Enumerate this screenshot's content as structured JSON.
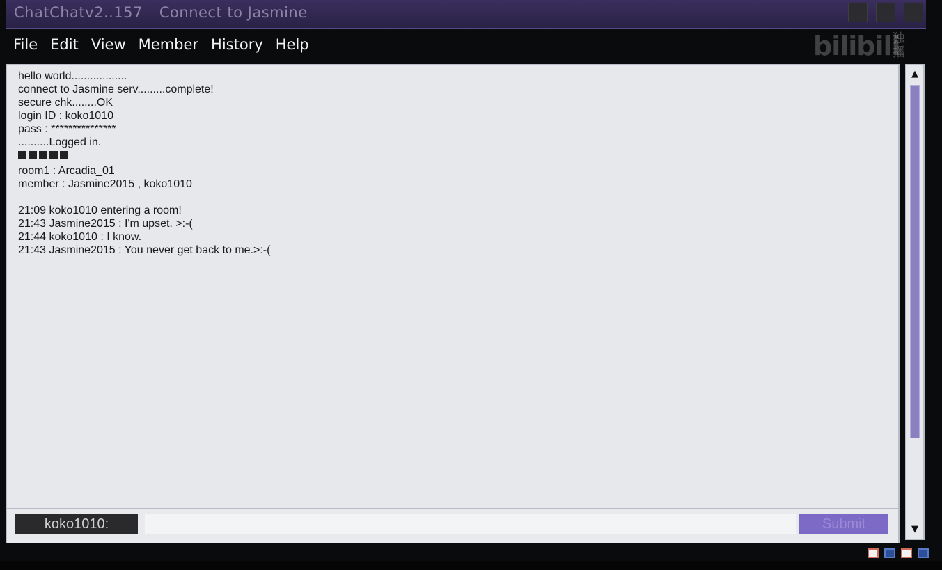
{
  "window": {
    "app_name": "ChatChatv2..157",
    "title": "Connect to Jasmine"
  },
  "menu": [
    "File",
    "Edit",
    "View",
    "Member",
    "History",
    "Help"
  ],
  "watermark": {
    "brand": "bilibili",
    "tag": "独播"
  },
  "log": [
    "hello world..................",
    "connect to Jasmine serv.........complete!",
    "secure chk........OK",
    "login ID : koko1010",
    "pass : ***************",
    "..........Logged in.",
    "",
    "room1 : Arcadia_01",
    "member : Jasmine2015 , koko1010",
    "",
    "21:09 koko1010 entering a room!",
    "21:43 Jasmine2015 : I'm upset. >:-(",
    "21:44 koko1010 : I know.",
    "21:43 Jasmine2015 : You never get back to me.>:-("
  ],
  "progress_blocks": 5,
  "composer": {
    "user_label": "koko1010:",
    "input_value": "",
    "submit_label": "Submit"
  },
  "scrollbar": {
    "up": "▲",
    "down": "▼"
  },
  "colors": {
    "titlebar": "#3a2f5e",
    "accent": "#7d6ac7",
    "chat_bg": "#e6e8ec",
    "scroll_thumb": "#8a7fbf"
  }
}
